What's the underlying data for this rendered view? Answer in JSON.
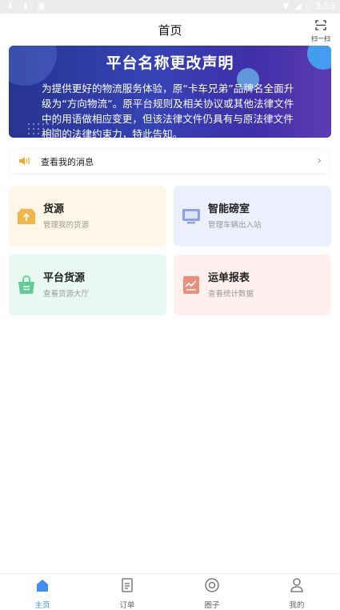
{
  "status_bar": {
    "time": "3:53"
  },
  "header": {
    "title": "首页",
    "scan_label": "扫一扫"
  },
  "banner": {
    "title": "平台名称更改声明",
    "text": "为提供更好的物流服务体验，原“卡车兄弟”品牌名全面升级为“方向物流”。原平台规则及相关协议或其他法律文件中的用语做相应变更，但该法律文件仍具有与原法律文件相同的法律约束力，特此告知。"
  },
  "message_bar": {
    "label": "查看我的消息"
  },
  "cards": [
    {
      "title": "货源",
      "subtitle": "管理我的货源",
      "bg": "#fef6e6",
      "icon_color": "#f3b54a",
      "icon": "upload-box-icon"
    },
    {
      "title": "智能磅室",
      "subtitle": "管理车辆出入站",
      "bg": "#ecf0fd",
      "icon_color": "#8da2e6",
      "icon": "monitor-icon"
    },
    {
      "title": "平台货源",
      "subtitle": "查看货源大厅",
      "bg": "#e9f8f0",
      "icon_color": "#5dcf94",
      "icon": "shopping-bag-icon"
    },
    {
      "title": "运单报表",
      "subtitle": "查看统计数据",
      "bg": "#fdf0ee",
      "icon_color": "#ef8d7a",
      "icon": "chart-report-icon"
    }
  ],
  "tabbar": {
    "active_color": "#3e8ef7",
    "inactive_color": "#666666",
    "items": [
      {
        "label": "主页",
        "icon": "home-icon",
        "active": true
      },
      {
        "label": "订单",
        "icon": "order-icon",
        "active": false
      },
      {
        "label": "圈子",
        "icon": "circle-icon",
        "active": false
      },
      {
        "label": "我的",
        "icon": "user-icon",
        "active": false
      }
    ]
  }
}
